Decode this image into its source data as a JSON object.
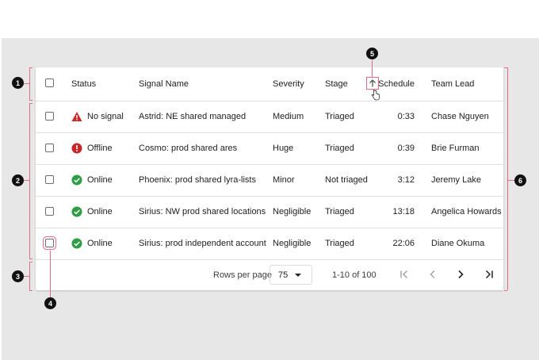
{
  "table": {
    "headers": {
      "status": "Status",
      "signal_name": "Signal Name",
      "severity": "Severity",
      "stage": "Stage",
      "schedule": "Schedule",
      "team_lead": "Team Lead"
    },
    "rows": [
      {
        "status_icon": "warning-icon",
        "status": "No signal",
        "signal_name": "Astrid: NE shared managed",
        "severity": "Medium",
        "stage": "Triaged",
        "schedule": "0:33",
        "team_lead": "Chase Nguyen"
      },
      {
        "status_icon": "error-icon",
        "status": "Offline",
        "signal_name": "Cosmo: prod shared ares",
        "severity": "Huge",
        "stage": "Triaged",
        "schedule": "0:39",
        "team_lead": "Brie Furman"
      },
      {
        "status_icon": "check-circle-icon",
        "status": "Online",
        "signal_name": "Phoenix: prod shared lyra-lists",
        "severity": "Minor",
        "stage": "Not triaged",
        "schedule": "3:12",
        "team_lead": "Jeremy Lake"
      },
      {
        "status_icon": "check-circle-icon",
        "status": "Online",
        "signal_name": "Sirius: NW prod shared locations",
        "severity": "Negligible",
        "stage": "Triaged",
        "schedule": "13:18",
        "team_lead": "Angelica Howards"
      },
      {
        "status_icon": "check-circle-icon",
        "status": "Online",
        "signal_name": "Sirius: prod independent account",
        "severity": "Negligible",
        "stage": "Triaged",
        "schedule": "22:06",
        "team_lead": "Diane Okuma"
      }
    ]
  },
  "pagination": {
    "rows_per_page_label": "Rows per page",
    "rows_per_page_value": "75",
    "range": "1-10 of 100"
  },
  "annotations": [
    "1",
    "2",
    "3",
    "4",
    "5",
    "6"
  ],
  "colors": {
    "warning": "#c62828",
    "error": "#c62828",
    "online": "#2e9e44",
    "annotation": "#e46a85",
    "badge": "#111111"
  }
}
